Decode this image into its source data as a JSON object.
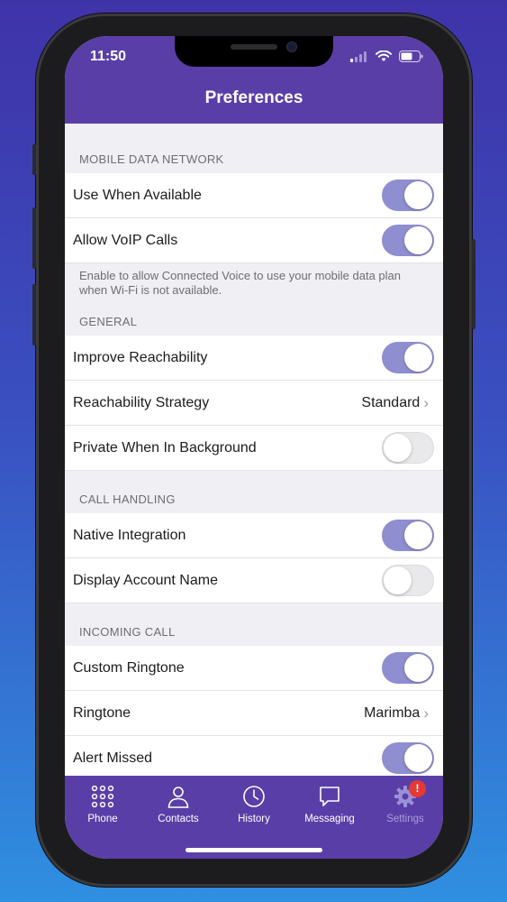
{
  "status": {
    "time": "11:50"
  },
  "header": {
    "title": "Preferences"
  },
  "sections": {
    "mobile": {
      "title": "MOBILE DATA NETWORK",
      "rows": [
        {
          "label": "Use When Available",
          "on": true
        },
        {
          "label": "Allow VoIP Calls",
          "on": true
        }
      ],
      "footer": "Enable to allow Connected Voice to use your mobile data plan when Wi-Fi is not available."
    },
    "general": {
      "title": "GENERAL",
      "rows": [
        {
          "label": "Improve Reachability",
          "on": true
        },
        {
          "label": "Reachability Strategy",
          "value": "Standard"
        },
        {
          "label": "Private When In Background",
          "on": false
        }
      ]
    },
    "call_handling": {
      "title": "CALL HANDLING",
      "rows": [
        {
          "label": "Native Integration",
          "on": true
        },
        {
          "label": "Display Account Name",
          "on": false
        }
      ]
    },
    "incoming": {
      "title": "INCOMING CALL",
      "rows": [
        {
          "label": "Custom Ringtone",
          "on": true
        },
        {
          "label": "Ringtone",
          "value": "Marimba"
        },
        {
          "label": "Alert Missed",
          "on": true
        }
      ]
    }
  },
  "tabs": [
    {
      "label": "Phone",
      "icon": "dialpad-icon"
    },
    {
      "label": "Contacts",
      "icon": "contacts-icon"
    },
    {
      "label": "History",
      "icon": "clock-icon"
    },
    {
      "label": "Messaging",
      "icon": "chat-icon"
    },
    {
      "label": "Settings",
      "icon": "gear-icon",
      "active": true,
      "badge": "!"
    }
  ],
  "colors": {
    "accent": "#5a3ea8",
    "toggle_on": "#8f8ed0",
    "badge": "#e53935"
  }
}
